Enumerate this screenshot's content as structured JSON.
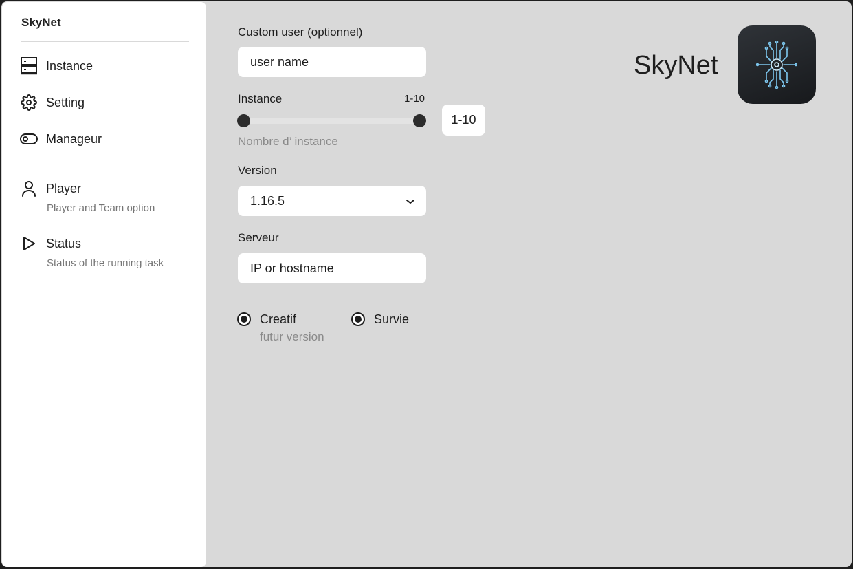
{
  "sidebar": {
    "brand": "SkyNet",
    "items": [
      {
        "label": "Instance",
        "icon": "server-icon"
      },
      {
        "label": "Setting",
        "icon": "gear-icon"
      },
      {
        "label": "Manageur",
        "icon": "toggle-icon"
      },
      {
        "label": "Player",
        "description": "Player and Team option",
        "icon": "user-icon"
      },
      {
        "label": "Status",
        "description": "Status of the running task",
        "icon": "play-icon"
      }
    ]
  },
  "form": {
    "custom_user": {
      "label": "Custom user (optionnel)",
      "placeholder": "user name"
    },
    "instance": {
      "label": "Instance",
      "range_text": "1-10",
      "range_box": "1-10",
      "min": 1,
      "max": 10,
      "hint": "Nombre d’ instance"
    },
    "version": {
      "label": "Version",
      "selected": "1.16.5"
    },
    "server": {
      "label": "Serveur",
      "placeholder": "IP or hostname"
    },
    "modes": [
      {
        "label": "Creatif",
        "description": "futur version",
        "selected": true
      },
      {
        "label": "Survie",
        "selected": true
      }
    ]
  },
  "header": {
    "title": "SkyNet",
    "logo_icon": "circuit-eye-icon"
  },
  "colors": {
    "background": "#d9d9d9",
    "sidebar": "#ffffff",
    "text": "#1e1e1e",
    "muted": "#757575",
    "logo_bg": "#1f2226",
    "logo_accent": "#7ec8f0"
  }
}
